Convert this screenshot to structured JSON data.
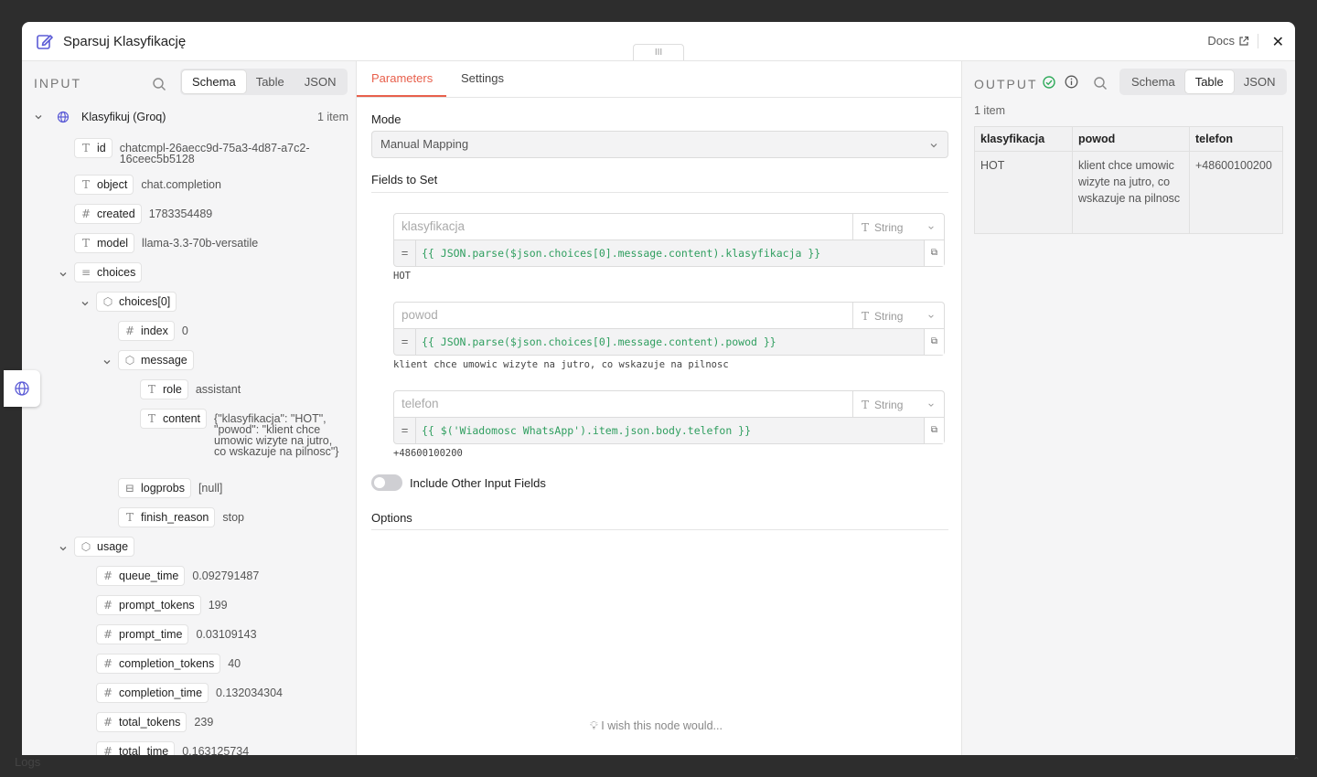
{
  "modal": {
    "title": "Sparsuj Klasyfikację",
    "docs_label": "Docs",
    "close_label": "✕",
    "handle_label": "III"
  },
  "input": {
    "label": "INPUT",
    "views": [
      "Schema",
      "Table",
      "JSON"
    ],
    "active_view": "Schema",
    "node_name": "Klasyfikuj (Groq)",
    "item_count": "1 item",
    "fields": {
      "id": {
        "key": "id",
        "type": "T",
        "value": "chatcmpl-26aecc9d-75a3-4d87-a7c2-16ceec5b5128"
      },
      "object": {
        "key": "object",
        "type": "T",
        "value": "chat.completion"
      },
      "created": {
        "key": "created",
        "type": "#",
        "value": "1783354489"
      },
      "model": {
        "key": "model",
        "type": "T",
        "value": "llama-3.3-70b-versatile"
      },
      "choices": {
        "key": "choices",
        "type": "≡"
      },
      "choices0": {
        "key": "choices[0]",
        "type": "⬡"
      },
      "index": {
        "key": "index",
        "type": "#",
        "value": "0"
      },
      "message": {
        "key": "message",
        "type": "⬡"
      },
      "role": {
        "key": "role",
        "type": "T",
        "value": "assistant"
      },
      "content": {
        "key": "content",
        "type": "T",
        "value": "{\"klasyfikacja\": \"HOT\", \"powod\": \"klient chce umowic wizyte na jutro, co wskazuje na pilnosc\"}"
      },
      "logprobs": {
        "key": "logprobs",
        "type": "⊟",
        "value": "[null]"
      },
      "finish_reason": {
        "key": "finish_reason",
        "type": "T",
        "value": "stop"
      },
      "usage": {
        "key": "usage",
        "type": "⬡"
      },
      "queue_time": {
        "key": "queue_time",
        "type": "#",
        "value": "0.092791487"
      },
      "prompt_tokens": {
        "key": "prompt_tokens",
        "type": "#",
        "value": "199"
      },
      "prompt_time": {
        "key": "prompt_time",
        "type": "#",
        "value": "0.03109143"
      },
      "completion_tokens": {
        "key": "completion_tokens",
        "type": "#",
        "value": "40"
      },
      "completion_time": {
        "key": "completion_time",
        "type": "#",
        "value": "0.132034304"
      },
      "total_tokens": {
        "key": "total_tokens",
        "type": "#",
        "value": "239"
      },
      "total_time": {
        "key": "total_time",
        "type": "#",
        "value": "0.163125734"
      }
    }
  },
  "params": {
    "tabs": [
      "Parameters",
      "Settings"
    ],
    "active_tab": "Parameters",
    "mode_label": "Mode",
    "mode_value": "Manual Mapping",
    "fields_label": "Fields to Set",
    "fields": [
      {
        "name": "klasyfikacja",
        "type": "String",
        "eq": "=",
        "expression": "{{ JSON.parse($json.choices[0].message.content).klasyfikacja }}",
        "result": "HOT"
      },
      {
        "name": "powod",
        "type": "String",
        "eq": "=",
        "expression": "{{ JSON.parse($json.choices[0].message.content).powod }}",
        "result": "klient chce umowic wizyte na jutro, co wskazuje na pilnosc"
      },
      {
        "name": "telefon",
        "type": "String",
        "eq": "=",
        "expression": "{{ $('Wiadomosc WhatsApp').item.json.body.telefon }}",
        "result": "+48600100200"
      }
    ],
    "include_other_label": "Include Other Input Fields",
    "include_other_on": false,
    "options_label": "Options",
    "wish_label": "I wish this node would..."
  },
  "output": {
    "label": "OUTPUT",
    "views": [
      "Schema",
      "Table",
      "JSON"
    ],
    "active_view": "Table",
    "item_count": "1 item",
    "columns": [
      "klasyfikacja",
      "powod",
      "telefon"
    ],
    "rows": [
      [
        "HOT",
        "klient chce umowic wizyte na jutro, co wskazuje na pilnosc",
        "+48600100200"
      ]
    ]
  },
  "footer": {
    "logs_label": "Logs",
    "chevron": "⌃"
  },
  "colors": {
    "accent": "#e8604c",
    "success": "#2faa5a",
    "expression": "#2f9e5f",
    "brand_icon": "#5b5bd6"
  }
}
